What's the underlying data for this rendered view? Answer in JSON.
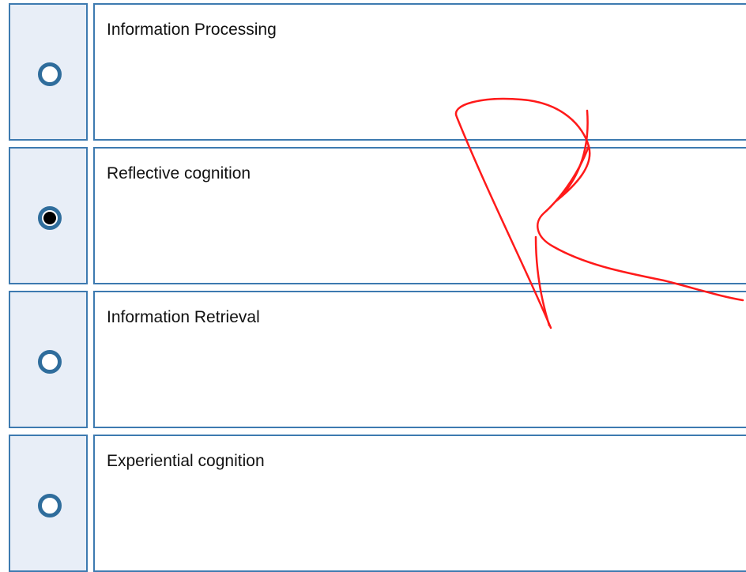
{
  "options": [
    {
      "label": "Information Processing",
      "selected": false
    },
    {
      "label": "Reflective cognition",
      "selected": true
    },
    {
      "label": "Information Retrieval",
      "selected": false
    },
    {
      "label": "Experiential cognition",
      "selected": false
    }
  ],
  "colors": {
    "border": "#3d7ab0",
    "radio_cell_bg": "#e8eef7",
    "radio_ring": "#2f6d9c",
    "annotation_stroke": "#ff1a1a"
  },
  "annotation": {
    "type": "freehand-letter",
    "glyph": "R"
  }
}
